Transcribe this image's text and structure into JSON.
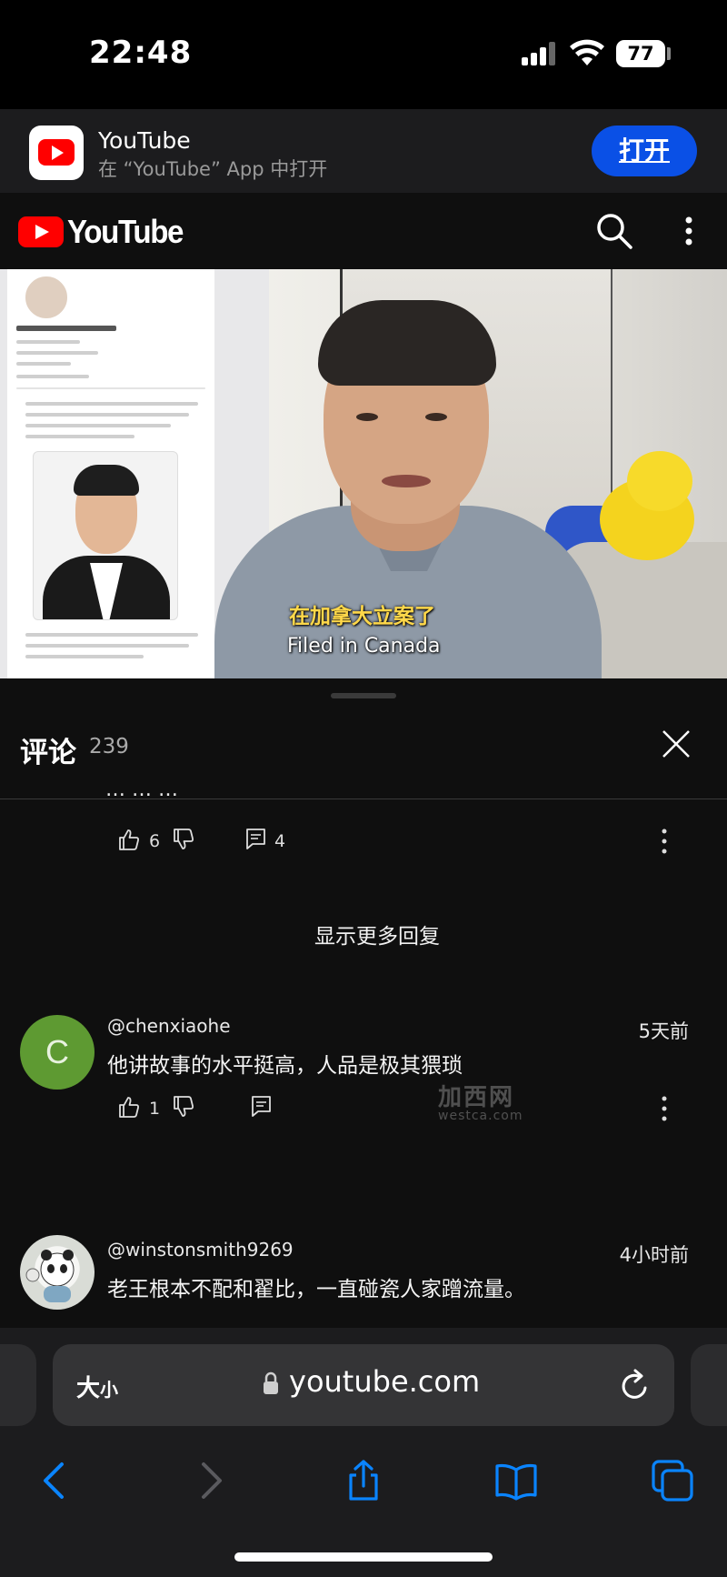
{
  "status_bar": {
    "time": "22:48",
    "battery": "77"
  },
  "app_banner": {
    "app_name": "YouTube",
    "subtitle": "在 “YouTube” App 中打开",
    "open_label": "打开"
  },
  "header": {
    "logo_text": "YouTube"
  },
  "video": {
    "subtitle_zh": "在加拿大立案了",
    "subtitle_en": "Filed in Canada"
  },
  "comments_panel": {
    "title": "评论",
    "count": "239",
    "first_reply_actions": {
      "likes": "6",
      "replies": "4"
    },
    "show_more_replies": "显示更多回复",
    "comments": [
      {
        "avatar_letter": "C",
        "handle": "@chenxiaohe",
        "time": "5天前",
        "text": "他讲故事的水平挺高，人品是极其猥琐",
        "likes": "1"
      },
      {
        "handle": "@winstonsmith9269",
        "time": "4小时前",
        "text": "老王根本不配和翟比，一直碰瓷人家蹭流量。"
      }
    ],
    "watermark_main": "加西网",
    "watermark_sub": "westca.com"
  },
  "safari": {
    "text_size_label": "大",
    "text_size_small": "小",
    "url": "youtube.com"
  },
  "colors": {
    "youtube_red": "#ff0000",
    "open_button_blue": "#0a50e6",
    "safari_accent": "#0a84ff",
    "avatar_green": "#5e9a32"
  },
  "icons": [
    "search-icon",
    "more-vert-icon",
    "close-icon",
    "thumb-up-icon",
    "thumb-down-icon",
    "reply-icon",
    "lock-icon",
    "reload-icon",
    "back-icon",
    "forward-icon",
    "share-icon",
    "bookmarks-icon",
    "tabs-icon"
  ]
}
